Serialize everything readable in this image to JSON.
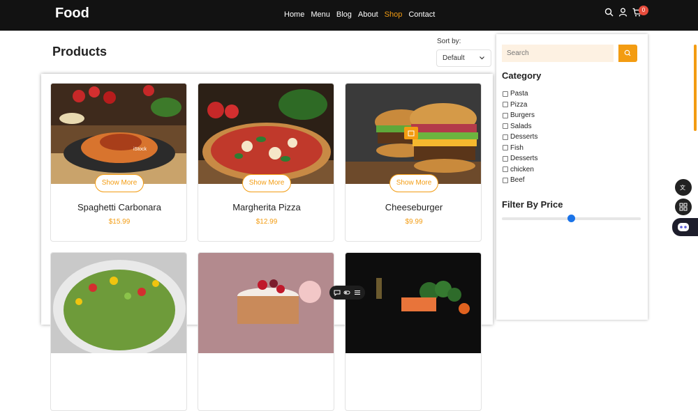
{
  "header": {
    "brand": "Food",
    "nav": [
      {
        "label": "Home",
        "active": false
      },
      {
        "label": "Menu",
        "active": false
      },
      {
        "label": "Blog",
        "active": false
      },
      {
        "label": "About",
        "active": false
      },
      {
        "label": "Shop",
        "active": true
      },
      {
        "label": "Contact",
        "active": false
      }
    ],
    "icons": [
      "search-icon",
      "user-icon",
      "cart-icon"
    ],
    "cart_count": "0"
  },
  "main": {
    "title": "Products",
    "sort_label": "Sort by:",
    "sort_value": "Default"
  },
  "products": [
    {
      "name": "Spaghetti Carbonara",
      "price": "$15.99",
      "button": "Show More",
      "image": "pasta-photo",
      "watermark": "iStock"
    },
    {
      "name": "Margherita Pizza",
      "price": "$12.99",
      "button": "Show More",
      "image": "pizza-photo"
    },
    {
      "name": "Cheeseburger",
      "price": "$9.99",
      "button": "Show More",
      "image": "burger-photo"
    },
    {
      "image": "salad-photo"
    },
    {
      "image": "cake-photo"
    },
    {
      "image": "salmon-vegetables-photo"
    }
  ],
  "sidebar": {
    "search_placeholder": "Search",
    "category_title": "Category",
    "categories": [
      "Pasta",
      "Pizza",
      "Burgers",
      "Salads",
      "Desserts",
      "Fish",
      "Desserts",
      "chicken",
      "Beef"
    ],
    "price_title": "Filter By Price",
    "price_slider_fraction": 0.5
  },
  "colors": {
    "accent": "#f39c12",
    "header_bg": "#121212",
    "badge": "#e74c3c",
    "slider": "#1a73e8"
  }
}
